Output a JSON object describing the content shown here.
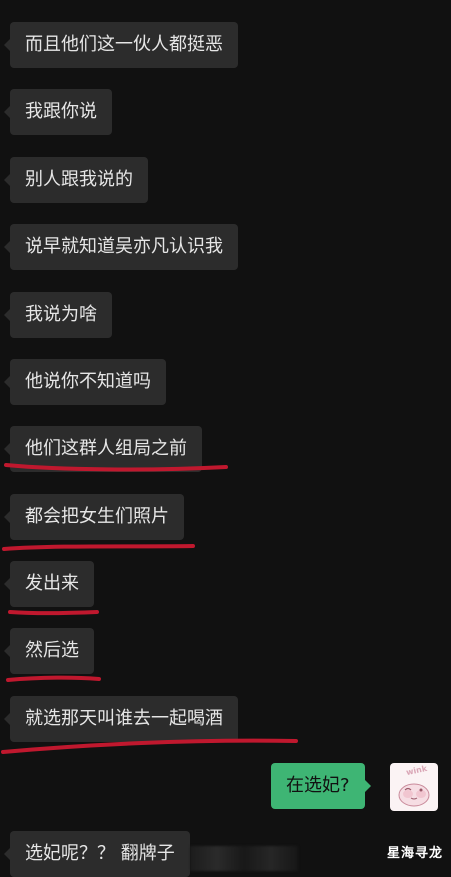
{
  "messages": [
    {
      "text": "而且他们这一伙人都挺恶",
      "side": "left"
    },
    {
      "text": "我跟你说",
      "side": "left"
    },
    {
      "text": "别人跟我说的",
      "side": "left"
    },
    {
      "text": "说早就知道吴亦凡认识我",
      "side": "left"
    },
    {
      "text": "我说为啥",
      "side": "left"
    },
    {
      "text": "他说你不知道吗",
      "side": "left"
    },
    {
      "text": "他们这群人组局之前",
      "side": "left"
    },
    {
      "text": "都会把女生们照片",
      "side": "left"
    },
    {
      "text": "发出来",
      "side": "left"
    },
    {
      "text": "然后选",
      "side": "left"
    },
    {
      "text": "就选那天叫谁去一起喝酒",
      "side": "left"
    },
    {
      "text": "在选妃?",
      "side": "right"
    },
    {
      "text": "选妃呢？？ 翻牌子",
      "side": "left"
    }
  ],
  "avatar": {
    "label": "wink",
    "icon": "cartoon-avatar-icon"
  },
  "watermark": "星海寻龙",
  "colors": {
    "background": "#111111",
    "incoming_bubble": "#2c2c2c",
    "outgoing_bubble": "#3eb574",
    "underline": "#c0182e"
  }
}
